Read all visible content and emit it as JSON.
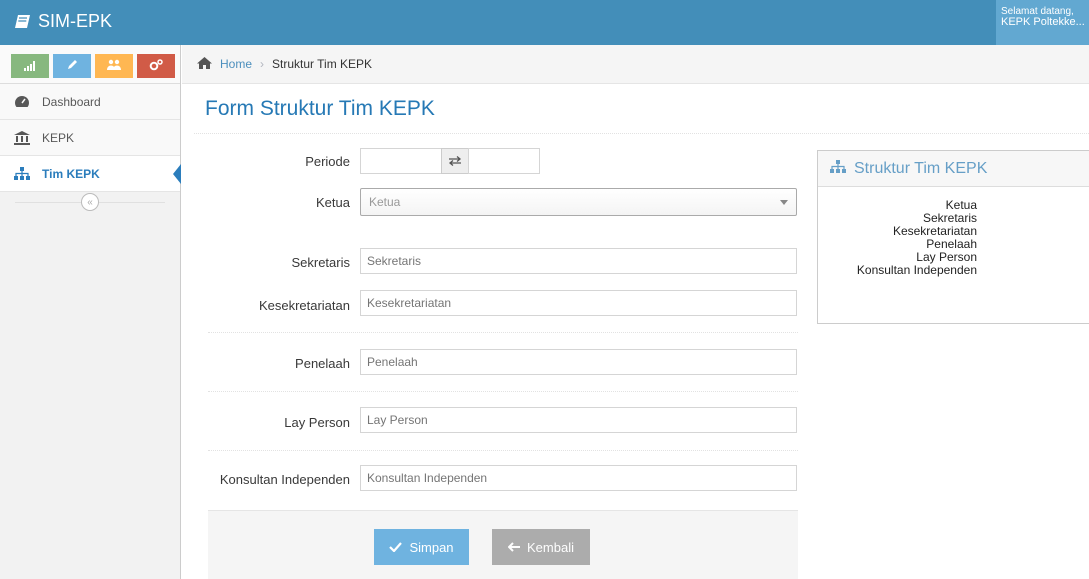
{
  "app": {
    "title": "SIM-EPK"
  },
  "user": {
    "greeting": "Selamat datang,",
    "name": "KEPK Poltekke..."
  },
  "shortcuts": [
    {
      "icon": "signal-icon"
    },
    {
      "icon": "pencil-icon"
    },
    {
      "icon": "users-icon"
    },
    {
      "icon": "cogs-icon"
    }
  ],
  "sidebar": {
    "items": [
      {
        "label": "Dashboard",
        "icon": "tachometer-icon"
      },
      {
        "label": "KEPK",
        "icon": "institution-icon"
      },
      {
        "label": "Tim KEPK",
        "icon": "sitemap-icon",
        "active": true
      }
    ]
  },
  "breadcrumb": {
    "home": "Home",
    "current": "Struktur Tim KEPK"
  },
  "page": {
    "title": "Form Struktur Tim KEPK"
  },
  "form": {
    "periode_label": "Periode",
    "ketua_label": "Ketua",
    "ketua_placeholder": "Ketua",
    "sekretaris_label": "Sekretaris",
    "sekretaris_placeholder": "Sekretaris",
    "kesekretariatan_label": "Kesekretariatan",
    "kesekretariatan_placeholder": "Kesekretariatan",
    "penelaah_label": "Penelaah",
    "penelaah_placeholder": "Penelaah",
    "lay_person_label": "Lay Person",
    "lay_person_placeholder": "Lay Person",
    "konsultan_label": "Konsultan Independen",
    "konsultan_placeholder": "Konsultan Independen",
    "save_label": "Simpan",
    "back_label": "Kembali"
  },
  "widget": {
    "title": "Struktur Tim KEPK",
    "roles": [
      "Ketua",
      "Sekretaris",
      "Kesekretariatan",
      "Penelaah",
      "Lay Person",
      "Konsultan Independen"
    ]
  },
  "colors": {
    "navbar": "#438eb9",
    "primary_button": "#6fb3e0",
    "title": "#2679b5"
  }
}
